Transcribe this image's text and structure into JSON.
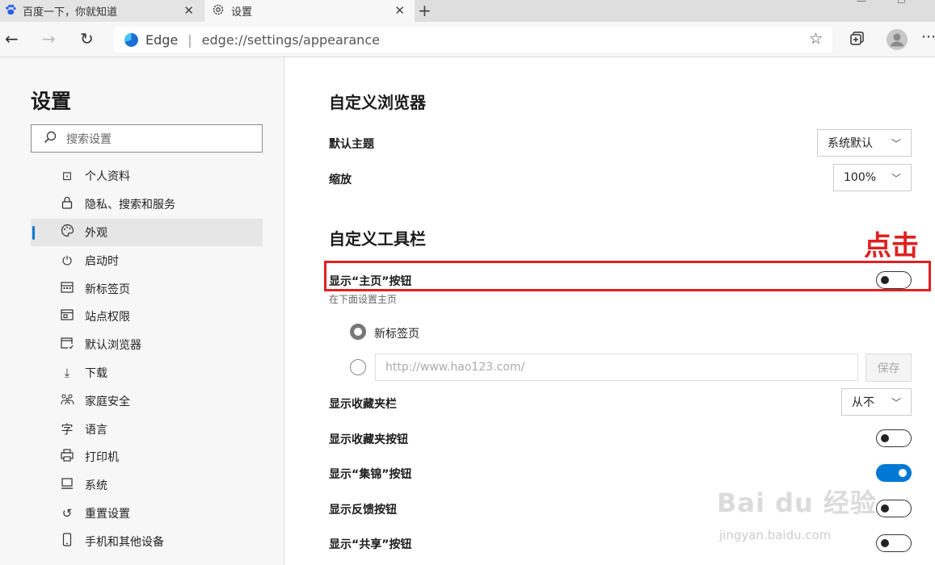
{
  "tabs": [
    {
      "title": "百度一下，你就知道",
      "icon": "baidu-paw-icon"
    },
    {
      "title": "设置",
      "icon": "gear-icon"
    }
  ],
  "address_bar": {
    "brand": "Edge",
    "url": "edge://settings/appearance"
  },
  "sidebar": {
    "title": "设置",
    "search_placeholder": "搜索设置",
    "items": [
      {
        "label": "个人资料",
        "icon": "profile-icon"
      },
      {
        "label": "隐私、搜索和服务",
        "icon": "lock-icon"
      },
      {
        "label": "外观",
        "icon": "palette-icon",
        "active": true
      },
      {
        "label": "启动时",
        "icon": "power-icon"
      },
      {
        "label": "新标签页",
        "icon": "new-tab-icon"
      },
      {
        "label": "站点权限",
        "icon": "site-permissions-icon"
      },
      {
        "label": "默认浏览器",
        "icon": "default-browser-icon"
      },
      {
        "label": "下载",
        "icon": "download-icon"
      },
      {
        "label": "家庭安全",
        "icon": "family-icon"
      },
      {
        "label": "语言",
        "icon": "language-icon"
      },
      {
        "label": "打印机",
        "icon": "printer-icon"
      },
      {
        "label": "系统",
        "icon": "system-icon"
      },
      {
        "label": "重置设置",
        "icon": "reset-icon"
      },
      {
        "label": "手机和其他设备",
        "icon": "phone-icon"
      }
    ]
  },
  "main": {
    "browser_section": {
      "heading": "自定义浏览器",
      "theme_label": "默认主题",
      "theme_value": "系统默认",
      "zoom_label": "缩放",
      "zoom_value": "100%"
    },
    "toolbar_section": {
      "heading": "自定义工具栏",
      "home_button_label": "显示“主页”按钮",
      "home_button_on": false,
      "home_sub": "在下面设置主页",
      "radio_newtab_label": "新标签页",
      "url_placeholder": "http://www.hao123.com/",
      "save_label": "保存",
      "favorites_bar_label": "显示收藏夹栏",
      "favorites_bar_value": "从不",
      "favorites_button_label": "显示收藏夹按钮",
      "favorites_button_on": false,
      "collections_label": "显示“集锦”按钮",
      "collections_on": true,
      "feedback_label": "显示反馈按钮",
      "feedback_on": false,
      "share_label": "显示“共享”按钮",
      "share_on": false
    }
  },
  "annotation": {
    "text": "点击",
    "color": "#e02020"
  },
  "watermark": {
    "brand": "Bai du 经验",
    "url": "jingyan.baidu.com"
  },
  "colors": {
    "accent": "#0078d4",
    "annotation_red": "#e02020"
  }
}
